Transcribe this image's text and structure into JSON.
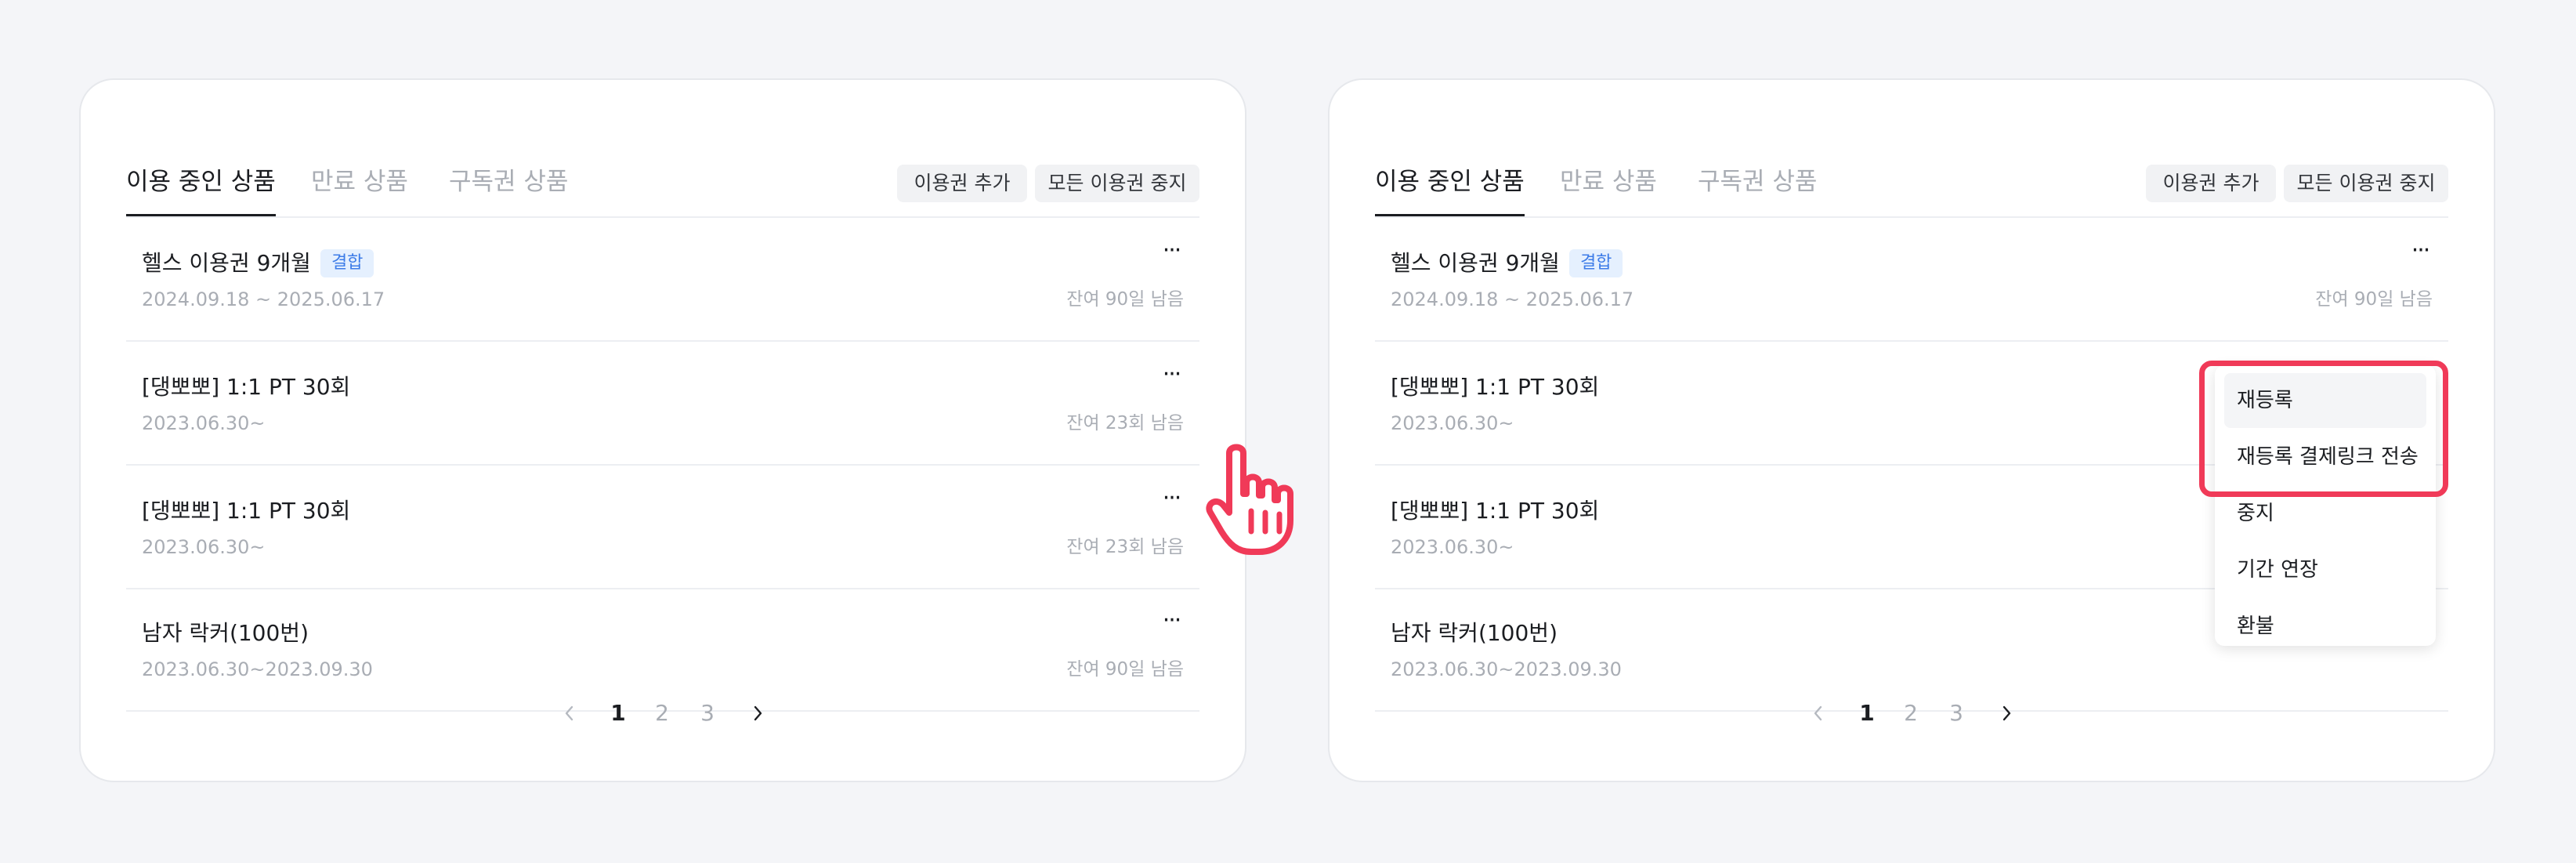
{
  "panels": [
    {
      "tabs": [
        "이용 중인 상품",
        "만료 상품",
        "구독권 상품"
      ],
      "active_tab": 0,
      "actions": {
        "add": "이용권 추가",
        "stop_all": "모든 이용권 중지"
      },
      "items": [
        {
          "title": "헬스 이용권 9개월",
          "badge": "결합",
          "date": "2024.09.18 ~ 2025.06.17",
          "remain": "잔여 90일 남음"
        },
        {
          "title": "[댕뽀뽀] 1:1 PT 30회",
          "date": "2023.06.30~",
          "remain": "잔여 23회 남음"
        },
        {
          "title": "[댕뽀뽀] 1:1 PT 30회",
          "date": "2023.06.30~",
          "remain": "잔여 23회 남음"
        },
        {
          "title": "남자 락커(100번)",
          "date": "2023.06.30~2023.09.30",
          "remain": "잔여 90일 남음"
        }
      ],
      "more_label": "···",
      "pagination": {
        "pages": [
          "1",
          "2",
          "3"
        ],
        "current": "1"
      }
    },
    {
      "tabs": [
        "이용 중인 상품",
        "만료 상품",
        "구독권 상품"
      ],
      "active_tab": 0,
      "actions": {
        "add": "이용권 추가",
        "stop_all": "모든 이용권 중지"
      },
      "items": [
        {
          "title": "헬스 이용권 9개월",
          "badge": "결합",
          "date": "2024.09.18 ~ 2025.06.17",
          "remain": "잔여 90일 남음"
        },
        {
          "title": "[댕뽀뽀] 1:1 PT 30회",
          "date": "2023.06.30~",
          "remain": ""
        },
        {
          "title": "[댕뽀뽀] 1:1 PT 30회",
          "date": "2023.06.30~",
          "remain": ""
        },
        {
          "title": "남자 락커(100번)",
          "date": "2023.06.30~2023.09.30",
          "remain": ""
        }
      ],
      "more_label": "···",
      "pagination": {
        "pages": [
          "1",
          "2",
          "3"
        ],
        "current": "1"
      },
      "context_menu": {
        "items": [
          "재등록",
          "재등록 결제링크 전송",
          "중지",
          "기간 연장",
          "환불"
        ],
        "hovered": 0,
        "highlighted": [
          0,
          1
        ]
      }
    }
  ],
  "colors": {
    "background": "#f4f5f8",
    "card": "#ffffff",
    "badge_bg": "#e5f0fe",
    "badge_text": "#3d7ce8",
    "highlight": "#f03a58",
    "muted_text": "#a9adb4"
  },
  "icons": [
    "chevron-left-icon",
    "chevron-right-icon",
    "more-icon",
    "hand-pointer-icon"
  ]
}
